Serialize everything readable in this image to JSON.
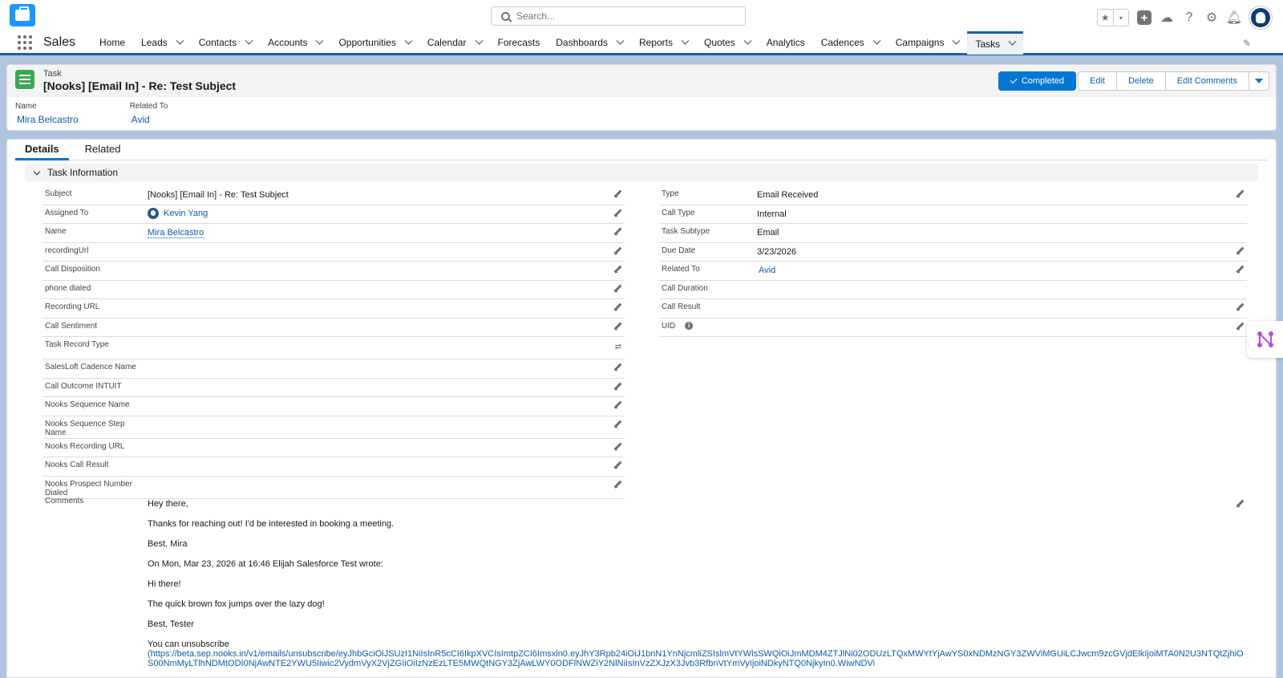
{
  "header": {
    "search_placeholder": "Search...",
    "fav_icon": "star-icon",
    "fav_dropdown": "▾"
  },
  "nav": {
    "app_name": "Sales",
    "items": [
      {
        "label": "Home",
        "has_menu": false
      },
      {
        "label": "Leads",
        "has_menu": true
      },
      {
        "label": "Contacts",
        "has_menu": true
      },
      {
        "label": "Accounts",
        "has_menu": true
      },
      {
        "label": "Opportunities",
        "has_menu": true
      },
      {
        "label": "Calendar",
        "has_menu": true
      },
      {
        "label": "Forecasts",
        "has_menu": false
      },
      {
        "label": "Dashboards",
        "has_menu": true
      },
      {
        "label": "Reports",
        "has_menu": true
      },
      {
        "label": "Quotes",
        "has_menu": true
      },
      {
        "label": "Analytics",
        "has_menu": false
      },
      {
        "label": "Cadences",
        "has_menu": true
      },
      {
        "label": "Campaigns",
        "has_menu": true
      },
      {
        "label": "Tasks",
        "has_menu": true,
        "active": true
      }
    ]
  },
  "record": {
    "object_label": "Task",
    "title": "[Nooks] [Email In] - Re: Test Subject",
    "actions": {
      "completed": "Completed",
      "edit": "Edit",
      "delete": "Delete",
      "edit_comments": "Edit Comments"
    },
    "highlights": {
      "name_label": "Name",
      "name_value": "Mira Belcastro",
      "related_label": "Related To",
      "related_value": "Avid"
    }
  },
  "tabs": {
    "details": "Details",
    "related": "Related"
  },
  "section": {
    "title": "Task Information"
  },
  "left_fields": {
    "subject": {
      "label": "Subject",
      "value": "[Nooks] [Email In] - Re: Test Subject"
    },
    "assigned_to": {
      "label": "Assigned To",
      "value": "Kevin Yang"
    },
    "name": {
      "label": "Name",
      "value": "Mira Belcastro"
    },
    "recording_url_lower": {
      "label": "recordingUrl",
      "value": ""
    },
    "call_disposition": {
      "label": "Call Disposition",
      "value": ""
    },
    "phone_dialed": {
      "label": "phone dialed",
      "value": ""
    },
    "recording_url": {
      "label": "Recording URL",
      "value": ""
    },
    "call_sentiment": {
      "label": "Call Sentiment",
      "value": ""
    },
    "task_record_type": {
      "label": "Task Record Type",
      "value": ""
    },
    "salesloft_cadence": {
      "label": "SalesLoft Cadence Name",
      "value": ""
    },
    "call_outcome": {
      "label": "Call Outcome INTUIT",
      "value": ""
    },
    "nooks_seq_name": {
      "label": "Nooks Sequence Name",
      "value": ""
    },
    "nooks_seq_step": {
      "label": "Nooks Sequence Step Name",
      "value": ""
    },
    "nooks_recording_url": {
      "label": "Nooks Recording URL",
      "value": ""
    },
    "nooks_call_result": {
      "label": "Nooks Call Result",
      "value": ""
    },
    "nooks_prospect_number": {
      "label": "Nooks Prospect Number Dialed",
      "value": ""
    }
  },
  "right_fields": {
    "type": {
      "label": "Type",
      "value": "Email Received"
    },
    "call_type": {
      "label": "Call Type",
      "value": "Internal"
    },
    "task_subtype": {
      "label": "Task Subtype",
      "value": "Email"
    },
    "due_date": {
      "label": "Due Date",
      "value": "3/23/2026"
    },
    "related_to": {
      "label": "Related To",
      "value": "Avid"
    },
    "call_duration": {
      "label": "Call Duration",
      "value": ""
    },
    "call_result": {
      "label": "Call Result",
      "value": ""
    },
    "uid": {
      "label": "UID",
      "value": ""
    }
  },
  "comments": {
    "label": "Comments",
    "lines": [
      "Hey there,",
      "Thanks for reaching out!  I'd be interested in booking a meeting.",
      "Best, Mira",
      "On Mon, Mar 23, 2026 at 16:46 Elijah Salesforce Test wrote:",
      "Hi there!",
      "The quick brown fox jumps over the lazy dog!",
      "Best, Tester"
    ],
    "unsubscribe_prefix": "You can unsubscribe",
    "unsubscribe_url": "(https://beta.sep.nooks.in/v1/emails/unsubscribe/eyJhbGciOiJSUzI1NiIsInR5cCI6IkpXVCIsImtpZCI6Imsxln0.eyJhY3Rpb24iOiJ1bnN1YnNjcmliZSIslmVtYWlsSWQiOiJmMDM4ZTJlNi02ODUzLTQxMWYtYjAwYS0xNDMzNGY3ZWViMGUiLCJwcm9zcGVjdElkIjoiMTA0N2U3NTQtZjhiOS00NmMyLTlhNDMtODI0NjAwNTE2YWU5Iiwic2VydmVyX2VjZGIiOiIzNzEzLTE5MWQtNGY3ZjAwLWY0ODFlNWZiY2NlNiIsInVzZXJzX3Jvb3RfbnVtYmVyIjoiNDkyNTQ0NjkyIn0.WiwNDVi"
  }
}
